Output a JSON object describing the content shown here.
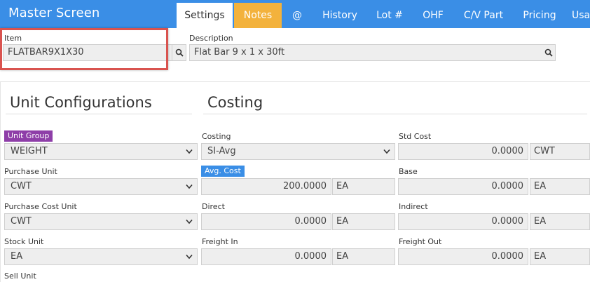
{
  "header": {
    "title": "Master Screen",
    "tabs": [
      {
        "label": "Settings"
      },
      {
        "label": "Notes"
      },
      {
        "label": "@"
      },
      {
        "label": "History"
      },
      {
        "label": "Lot #"
      },
      {
        "label": "OHF"
      },
      {
        "label": "C/V Part"
      },
      {
        "label": "Pricing"
      },
      {
        "label": "Usa"
      }
    ]
  },
  "item": {
    "label": "Item",
    "value": "FLATBAR9X1X30"
  },
  "description": {
    "label": "Description",
    "value": "Flat Bar 9 x 1 x 30ft"
  },
  "unit_config": {
    "title": "Unit Configurations",
    "unit_group": {
      "label": "Unit Group",
      "value": "WEIGHT"
    },
    "purchase_unit": {
      "label": "Purchase Unit",
      "value": "CWT"
    },
    "purchase_cost_unit": {
      "label": "Purchase Cost Unit",
      "value": "CWT"
    },
    "stock_unit": {
      "label": "Stock Unit",
      "value": "EA"
    },
    "sell_unit": {
      "label": "Sell Unit"
    }
  },
  "costing": {
    "title": "Costing",
    "costing": {
      "label": "Costing",
      "value": "SI-Avg"
    },
    "avg_cost": {
      "label": "Avg. Cost",
      "value": "200.0000",
      "unit": "EA"
    },
    "direct": {
      "label": "Direct",
      "value": "0.0000",
      "unit": "EA"
    },
    "freight_in": {
      "label": "Freight In",
      "value": "0.0000",
      "unit": "EA"
    },
    "std_cost": {
      "label": "Std Cost",
      "value": "0.0000",
      "unit": "CWT"
    },
    "base": {
      "label": "Base",
      "value": "0.0000",
      "unit": "EA"
    },
    "indirect": {
      "label": "Indirect",
      "value": "0.0000",
      "unit": "EA"
    },
    "freight_out": {
      "label": "Freight Out",
      "value": "0.0000",
      "unit": "EA"
    }
  },
  "colors": {
    "header_bg": "#3a8ee6",
    "notes_tab": "#f3b23c",
    "unit_group_badge": "#8e3ea8",
    "avg_cost_badge": "#3a8ee6",
    "highlight": "#d9534f"
  }
}
